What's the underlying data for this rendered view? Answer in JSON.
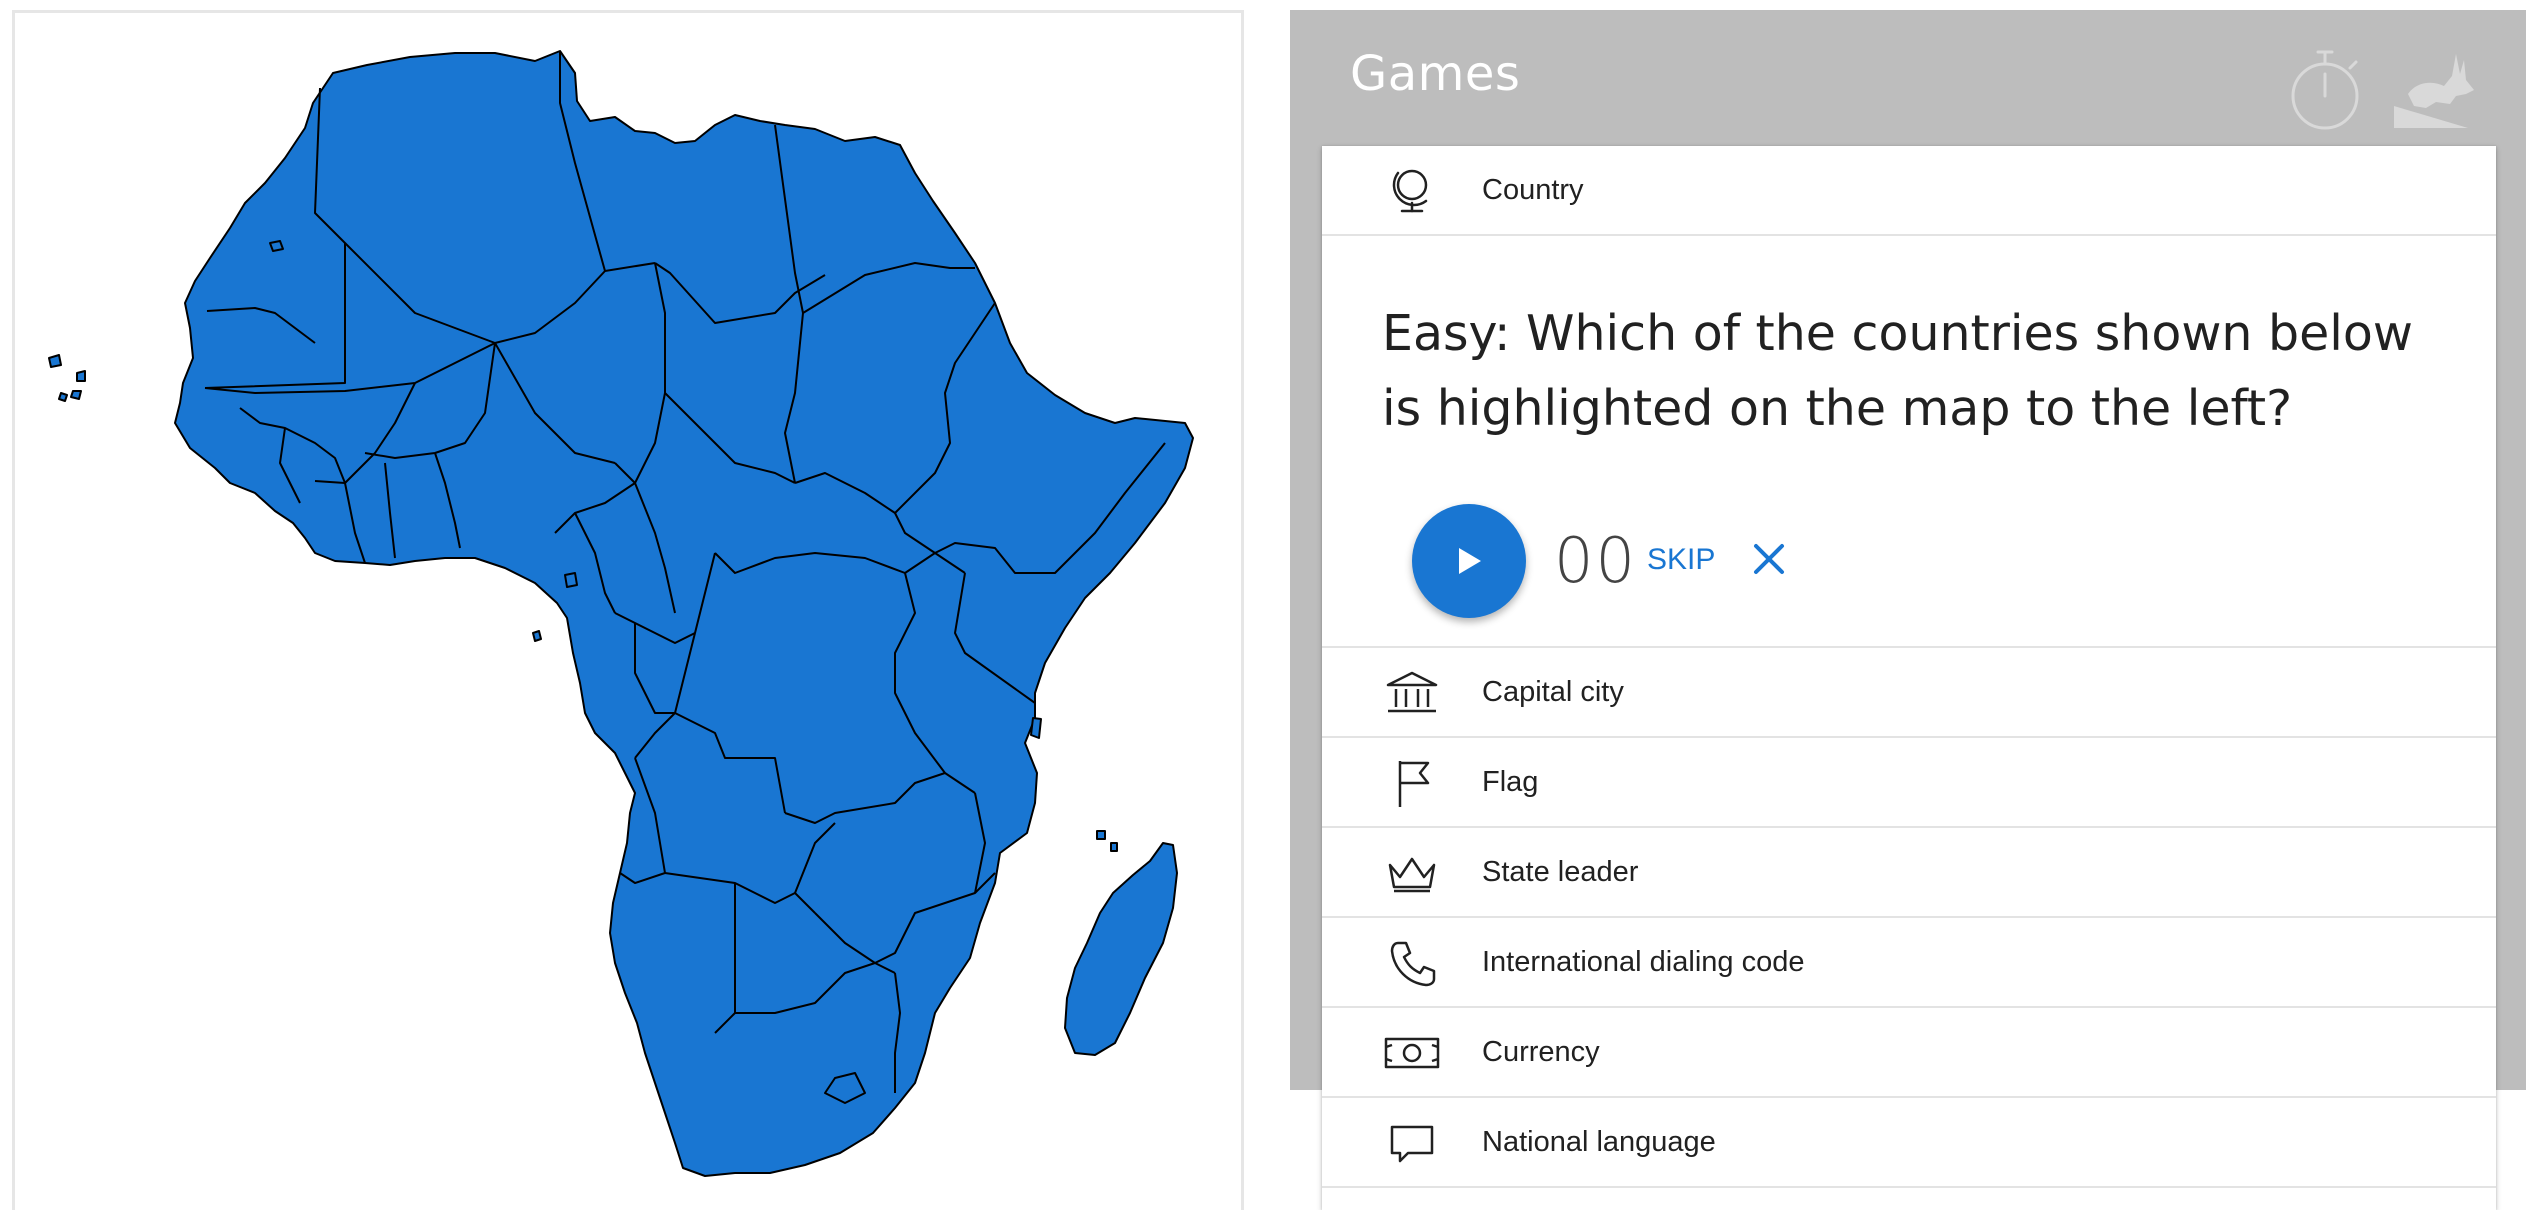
{
  "map": {
    "region": "Africa",
    "fill_color": "#1976d2",
    "border_color": "#000000"
  },
  "games": {
    "title": "Games",
    "header_icons": [
      "timer-icon",
      "hare-icon"
    ],
    "header_bg": "#bdbdbd"
  },
  "categories": {
    "country": {
      "label": "Country",
      "icon": "globe-icon"
    },
    "capital": {
      "label": "Capital city",
      "icon": "government-building-icon"
    },
    "flag": {
      "label": "Flag",
      "icon": "flag-icon"
    },
    "leader": {
      "label": "State leader",
      "icon": "crown-icon"
    },
    "dialing": {
      "label": "International dialing code",
      "icon": "phone-icon"
    },
    "currency": {
      "label": "Currency",
      "icon": "banknote-icon"
    },
    "language": {
      "label": "National language",
      "icon": "speech-bubble-icon"
    }
  },
  "question": {
    "text": "Easy: Which of the countries shown below is highlighted on the map to the left?",
    "score": "00",
    "skip_label": "SKIP",
    "accent_color": "#1976d2"
  }
}
